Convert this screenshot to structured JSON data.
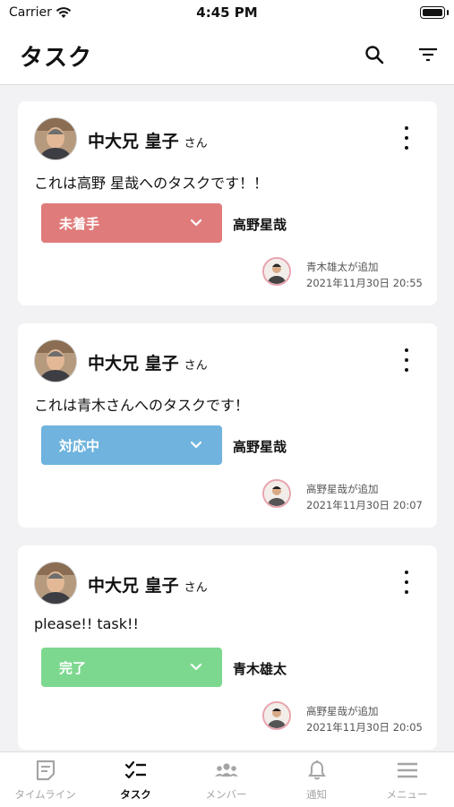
{
  "status_bar": {
    "carrier": "Carrier",
    "time": "4:45 PM"
  },
  "header": {
    "title": "タスク",
    "search_icon": "search-icon",
    "filter_icon": "filter-icon"
  },
  "colors": {
    "not_started": "#e07b7b",
    "in_progress": "#6fb3de",
    "done": "#7dd88f",
    "accent_border": "#e8a3ae"
  },
  "tasks": [
    {
      "author": "中大兄 皇子",
      "honorific": "さん",
      "text": "これは高野 星哉へのタスクです！！",
      "status": "未着手",
      "assignee": "高野星哉",
      "added_by": "青木雄太が追加",
      "added_at": "2021年11月30日 20:55"
    },
    {
      "author": "中大兄 皇子",
      "honorific": "さん",
      "text": "これは青木さんへのタスクです！",
      "status": "対応中",
      "assignee": "高野星哉",
      "added_by": "高野星哉が追加",
      "added_at": "2021年11月30日 20:07"
    },
    {
      "author": "中大兄 皇子",
      "honorific": "さん",
      "text": "please!! task!!",
      "status": "完了",
      "assignee": "青木雄太",
      "added_by": "高野星哉が追加",
      "added_at": "2021年11月30日 20:05"
    }
  ],
  "tabbar": [
    {
      "label": "タイムライン",
      "icon": "timeline-icon"
    },
    {
      "label": "タスク",
      "icon": "task-checklist-icon",
      "active": true
    },
    {
      "label": "メンバー",
      "icon": "members-icon"
    },
    {
      "label": "通知",
      "icon": "bell-icon"
    },
    {
      "label": "メニュー",
      "icon": "menu-icon"
    }
  ]
}
